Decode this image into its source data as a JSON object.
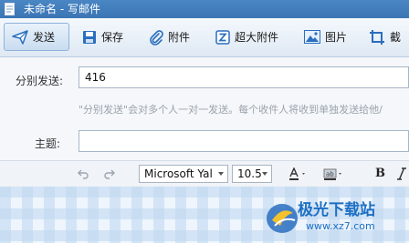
{
  "window": {
    "title": "未命名 - 写邮件"
  },
  "toolbar": {
    "send": "发送",
    "save": "保存",
    "attach": "附件",
    "big_attach": "超大附件",
    "image": "图片",
    "screenshot": "截"
  },
  "form": {
    "separate_send_label": "分别发送:",
    "to_value": "416",
    "hint": "\"分别发送\"会对多个人一对一发送。每个收件人将收到单独发送给他/",
    "subject_label": "主题:",
    "subject_value": ""
  },
  "format_bar": {
    "font_family": "Microsoft Yal",
    "font_size": "10.5",
    "bold": "B"
  },
  "watermark": {
    "site": "极光下载站",
    "url": "www.xz7.com"
  },
  "colors": {
    "titlebar": "#3b75b4",
    "accent": "#2a6ebf",
    "watermark": "#1d6fc4"
  }
}
